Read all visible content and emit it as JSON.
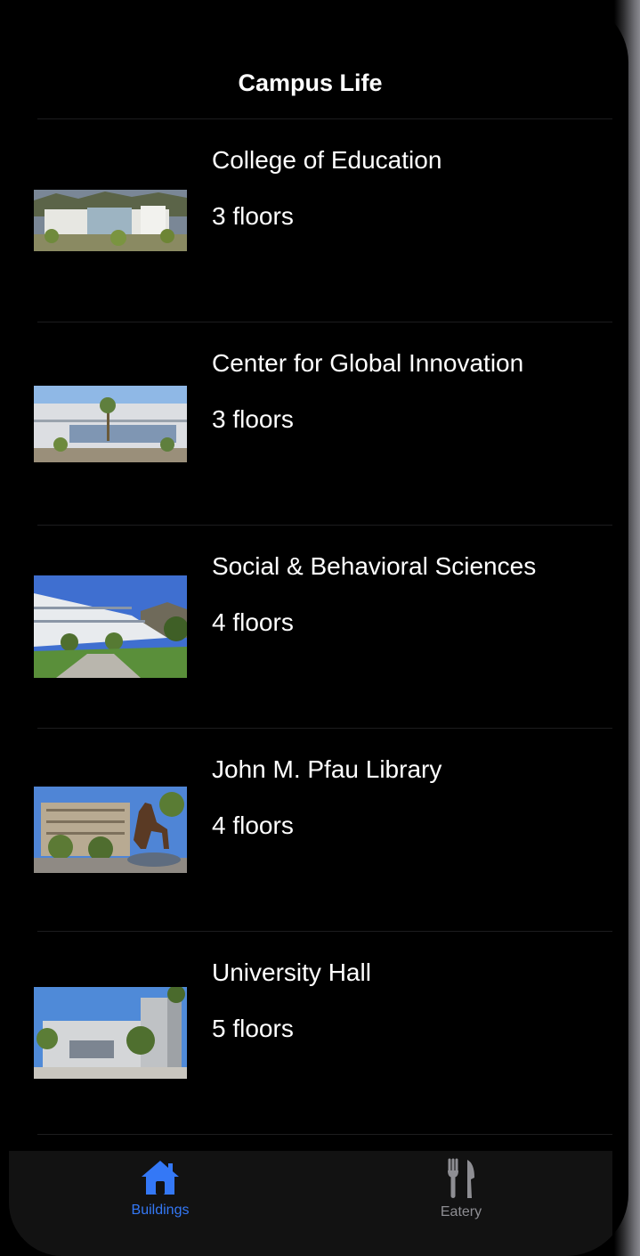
{
  "header": {
    "title": "Campus Life"
  },
  "buildings": [
    {
      "name": "College of Education",
      "floors": "3 floors",
      "photo": "college-of-education-photo"
    },
    {
      "name": "Center for Global Innovation",
      "floors": "3 floors",
      "photo": "global-innovation-photo"
    },
    {
      "name": "Social & Behavioral Sciences",
      "floors": "4 floors",
      "photo": "social-behavioral-photo"
    },
    {
      "name": "John M. Pfau Library",
      "floors": "4 floors",
      "photo": "pfau-library-photo"
    },
    {
      "name": "University Hall",
      "floors": "5 floors",
      "photo": "university-hall-photo"
    }
  ],
  "tabbar": {
    "tabs": [
      {
        "label": "Buildings",
        "icon": "house-icon",
        "selected": true
      },
      {
        "label": "Eatery",
        "icon": "fork-knife-icon",
        "selected": false
      }
    ]
  },
  "colors": {
    "accent": "#3478f6",
    "inactive": "#8e8e93",
    "background": "#000000"
  }
}
